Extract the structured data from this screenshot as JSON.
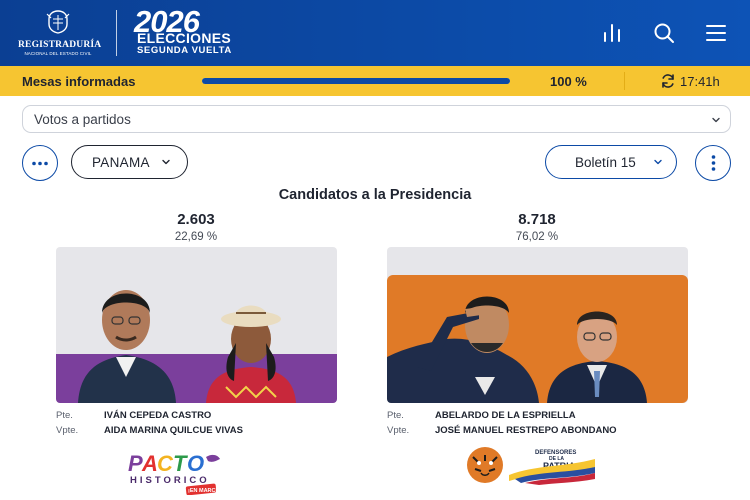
{
  "header": {
    "org_name": "REGISTRADURÍA",
    "org_sub": "NACIONAL DEL ESTADO CIVIL",
    "brand_year": "2026",
    "brand_line1": "ELECCIONES",
    "brand_line2": "SEGUNDA VUELTA",
    "icons": [
      "bar-chart-icon",
      "search-icon",
      "menu-icon"
    ]
  },
  "status": {
    "label": "Mesas informadas",
    "progress_percent": 100,
    "percent_text": "100 %",
    "time": "17:41h"
  },
  "view_select": {
    "value": "Votos a partidos"
  },
  "filters": {
    "region": "PANAMA",
    "bulletin": "Boletín 15"
  },
  "section_title": "Candidatos a la Presidencia",
  "candidates": [
    {
      "votes": "2.603",
      "percent": "22,69 %",
      "pres_role": "Pte.",
      "pres_name": "IVÁN CEPEDA CASTRO",
      "vp_role": "Vpte.",
      "vp_name": "AIDA MARINA QUILCUE VIVAS",
      "party_logo": "PACTO HISTÓRICO",
      "party_logo_tag": "¡EN MARCHA!",
      "colors": {
        "band": "#7b3f9c",
        "backdrop": "#e6e6ea"
      }
    },
    {
      "votes": "8.718",
      "percent": "76,02 %",
      "pres_role": "Pte.",
      "pres_name": "ABELARDO DE LA ESPRIELLA",
      "vp_role": "Vpte.",
      "vp_name": "JOSÉ MANUEL RESTREPO ABONDANO",
      "party_logo": "DEFENSORES DE LA PATRIA",
      "colors": {
        "band": "#e07a27",
        "backdrop": "#e6e6ea"
      }
    }
  ],
  "colors": {
    "header_blue": "#0c4aa6",
    "status_yellow": "#f6c531",
    "accent_blue": "#0c4aa6"
  }
}
